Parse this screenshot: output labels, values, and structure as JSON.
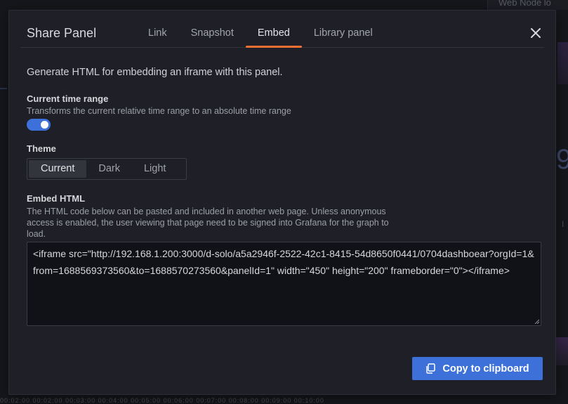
{
  "background": {
    "panel_title": "Web Node lo",
    "big_glyph": "9",
    "small_text": "I",
    "time_axis": "00:02:00 00:02:00 00:03:00 00:04:00 00:05:00 00:06:00 00:07:00 00:08:00 00:09:00 00:10:00"
  },
  "modal": {
    "title": "Share Panel",
    "tabs": [
      {
        "label": "Link"
      },
      {
        "label": "Snapshot"
      },
      {
        "label": "Embed"
      },
      {
        "label": "Library panel"
      }
    ],
    "active_tab": "Embed",
    "close_icon": "close-icon"
  },
  "embed": {
    "intro": "Generate HTML for embedding an iframe with this panel.",
    "time_range": {
      "label": "Current time range",
      "description": "Transforms the current relative time range to an absolute time range",
      "enabled": true
    },
    "theme": {
      "label": "Theme",
      "options": [
        "Current",
        "Dark",
        "Light"
      ],
      "selected": "Current"
    },
    "embed_html": {
      "label": "Embed HTML",
      "description": "The HTML code below can be pasted and included in another web page. Unless anonymous access is enabled, the user viewing that page need to be signed into Grafana for the graph to load.",
      "code": "<iframe src=\"http://192.168.1.200:3000/d-solo/a5a2946f-2522-42c1-8415-54d8650f0441/0704dashboear?orgId=1&from=1688569373560&to=1688570273560&panelId=1\" width=\"450\" height=\"200\" frameborder=\"0\"></iframe>"
    },
    "copy_button": {
      "label": "Copy to clipboard",
      "icon": "copy-icon"
    }
  },
  "colors": {
    "accent": "#3d71d9",
    "tab_underline": "#f26f34",
    "modal_bg": "#1f2027"
  }
}
